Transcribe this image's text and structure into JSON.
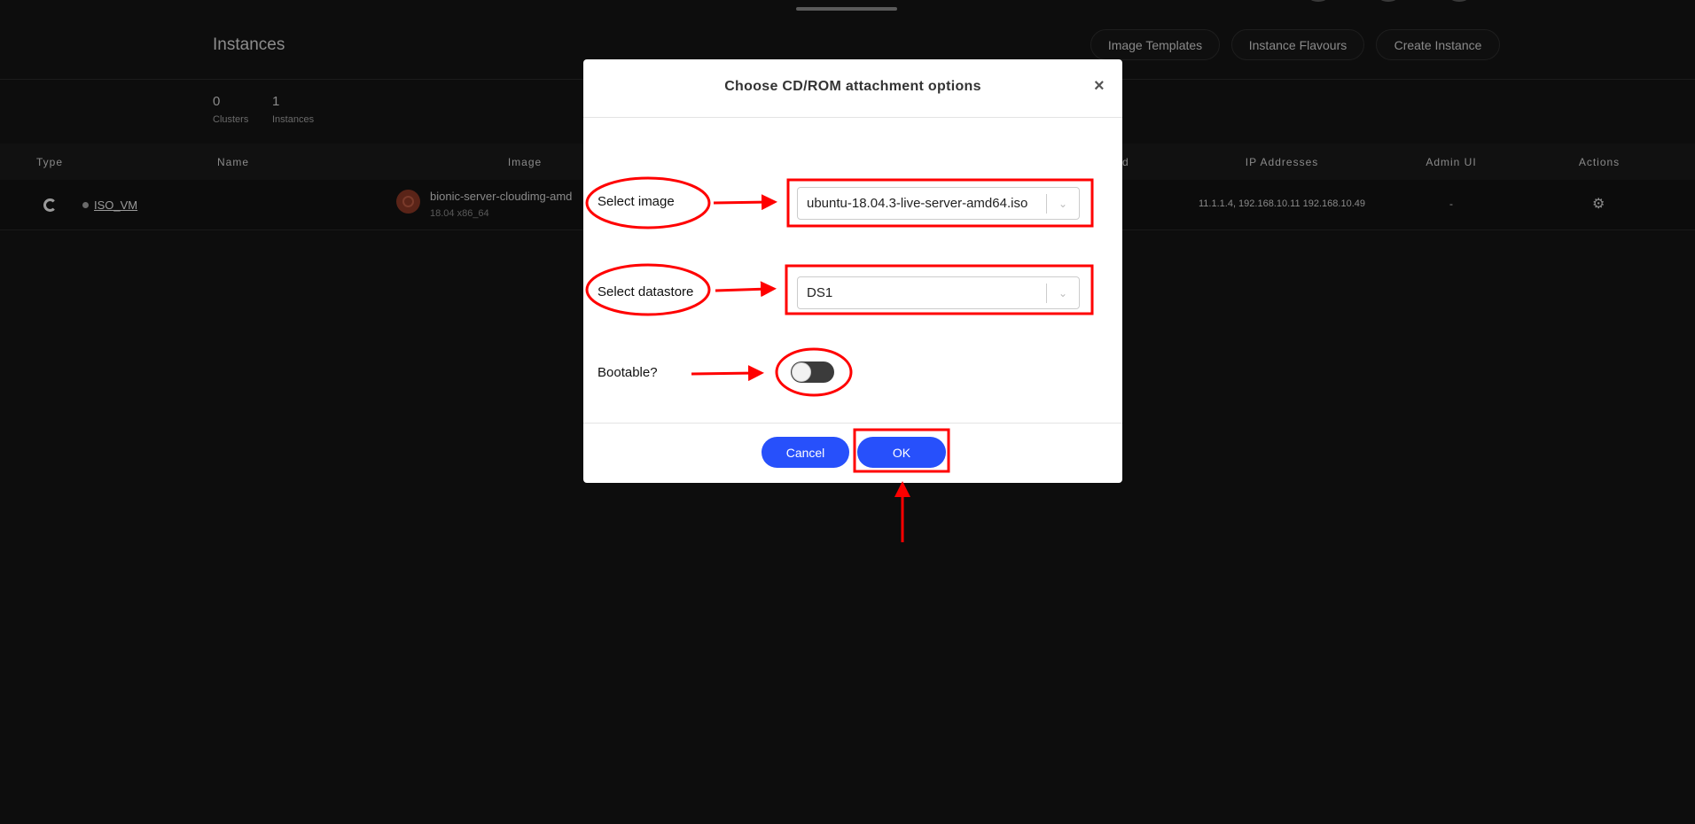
{
  "page": {
    "title": "Instances",
    "buttons": [
      "Image Templates",
      "Instance Flavours",
      "Create Instance"
    ],
    "stats": [
      {
        "value": "0",
        "label": "Clusters"
      },
      {
        "value": "1",
        "label": "Instances"
      }
    ]
  },
  "table": {
    "headers": [
      "Type",
      "Name",
      "Image",
      "ed",
      "IP Addresses",
      "Admin UI",
      "Actions"
    ],
    "rows": [
      {
        "name": "ISO_VM",
        "image": "bionic-server-cloudimg-amd",
        "image_sub": "18.04 x86_64",
        "ip": "11.1.1.4, 192.168.10.11 192.168.10.49",
        "admin_ui": "-",
        "status_color": "#6a6a6a"
      }
    ]
  },
  "modal": {
    "title": "Choose CD/ROM attachment options",
    "close": "×",
    "image_label": "Select image",
    "image_value": "ubuntu-18.04.3-live-server-amd64.iso",
    "datastore_label": "Select datastore",
    "datastore_value": "DS1",
    "bootable_label": "Bootable?",
    "bootable": false,
    "cancel": "Cancel",
    "ok": "OK"
  },
  "colors": {
    "accent": "#2750fb",
    "annotation": "#ff0000",
    "background": "#0d0d0d"
  }
}
